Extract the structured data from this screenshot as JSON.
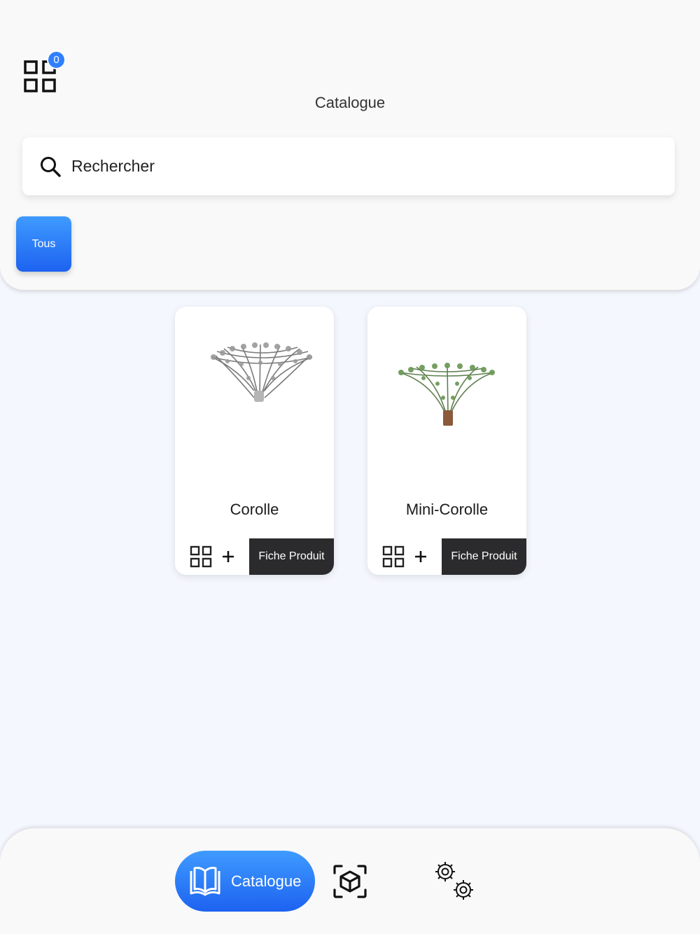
{
  "header": {
    "collection_count": "0",
    "title": "Catalogue"
  },
  "search": {
    "placeholder": "Rechercher"
  },
  "filters": [
    {
      "label": "Tous",
      "selected": true
    }
  ],
  "products": [
    {
      "name": "Corolle",
      "action_label": "Fiche Produit"
    },
    {
      "name": "Mini-Corolle",
      "action_label": "Fiche Produit"
    }
  ],
  "bottom_nav": {
    "catalogue_label": "Catalogue",
    "active": "catalogue",
    "ar_icon": "ar-cube-icon",
    "settings_icon": "settings-gears-icon"
  },
  "colors": {
    "accent_gradient_top": "#3f9bff",
    "accent_gradient_bottom": "#1d62f0",
    "fiche_button": "#2b2b2d",
    "badge": "#2f80ff"
  }
}
